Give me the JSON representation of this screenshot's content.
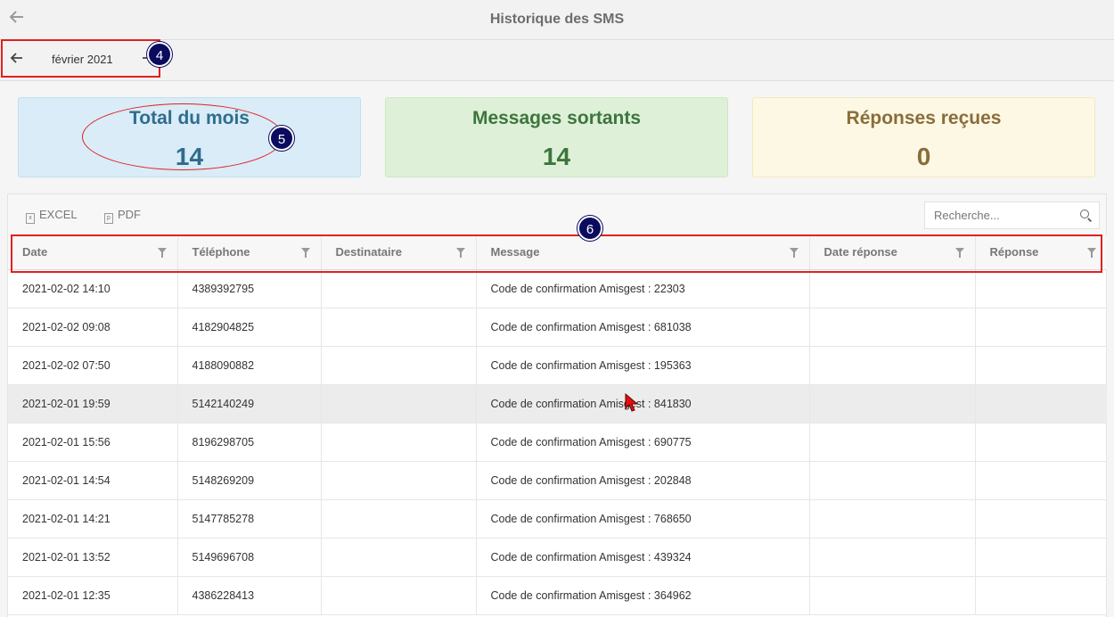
{
  "header": {
    "title": "Historique des SMS",
    "back_icon": "arrow-left-icon"
  },
  "month_nav": {
    "label": "février 2021",
    "prev_icon": "arrow-left-icon",
    "next_icon": "arrow-right-icon"
  },
  "cards": [
    {
      "title": "Total du mois",
      "value": "14",
      "color": "#2e6d8e"
    },
    {
      "title": "Messages sortants",
      "value": "14",
      "color": "#3c763d"
    },
    {
      "title": "Réponses reçues",
      "value": "0",
      "color": "#8a6d3b"
    }
  ],
  "annotations": {
    "badge_4": "4",
    "badge_5": "5",
    "badge_6": "6",
    "highlight_color": "#e02020",
    "badge_color": "#0a0a5e"
  },
  "toolbar": {
    "excel_label": "EXCEL",
    "pdf_label": "PDF",
    "search_placeholder": "Recherche..."
  },
  "table": {
    "columns": [
      "Date",
      "Téléphone",
      "Destinataire",
      "Message",
      "Date réponse",
      "Réponse"
    ],
    "rows": [
      [
        "2021-02-02 14:10",
        "4389392795",
        "",
        "Code de confirmation Amisgest : 22303",
        "",
        ""
      ],
      [
        "2021-02-02 09:08",
        "4182904825",
        "",
        "Code de confirmation Amisgest : 681038",
        "",
        ""
      ],
      [
        "2021-02-02 07:50",
        "4188090882",
        "",
        "Code de confirmation Amisgest : 195363",
        "",
        ""
      ],
      [
        "2021-02-01 19:59",
        "5142140249",
        "",
        "Code de confirmation Amisgest : 841830",
        "",
        ""
      ],
      [
        "2021-02-01 15:56",
        "8196298705",
        "",
        "Code de confirmation Amisgest : 690775",
        "",
        ""
      ],
      [
        "2021-02-01 14:54",
        "5148269209",
        "",
        "Code de confirmation Amisgest : 202848",
        "",
        ""
      ],
      [
        "2021-02-01 14:21",
        "5147785278",
        "",
        "Code de confirmation Amisgest : 768650",
        "",
        ""
      ],
      [
        "2021-02-01 13:52",
        "5149696708",
        "",
        "Code de confirmation Amisgest : 439324",
        "",
        ""
      ],
      [
        "2021-02-01 12:35",
        "4386228413",
        "",
        "Code de confirmation Amisgest : 364962",
        "",
        ""
      ]
    ],
    "selected_row": 3
  }
}
